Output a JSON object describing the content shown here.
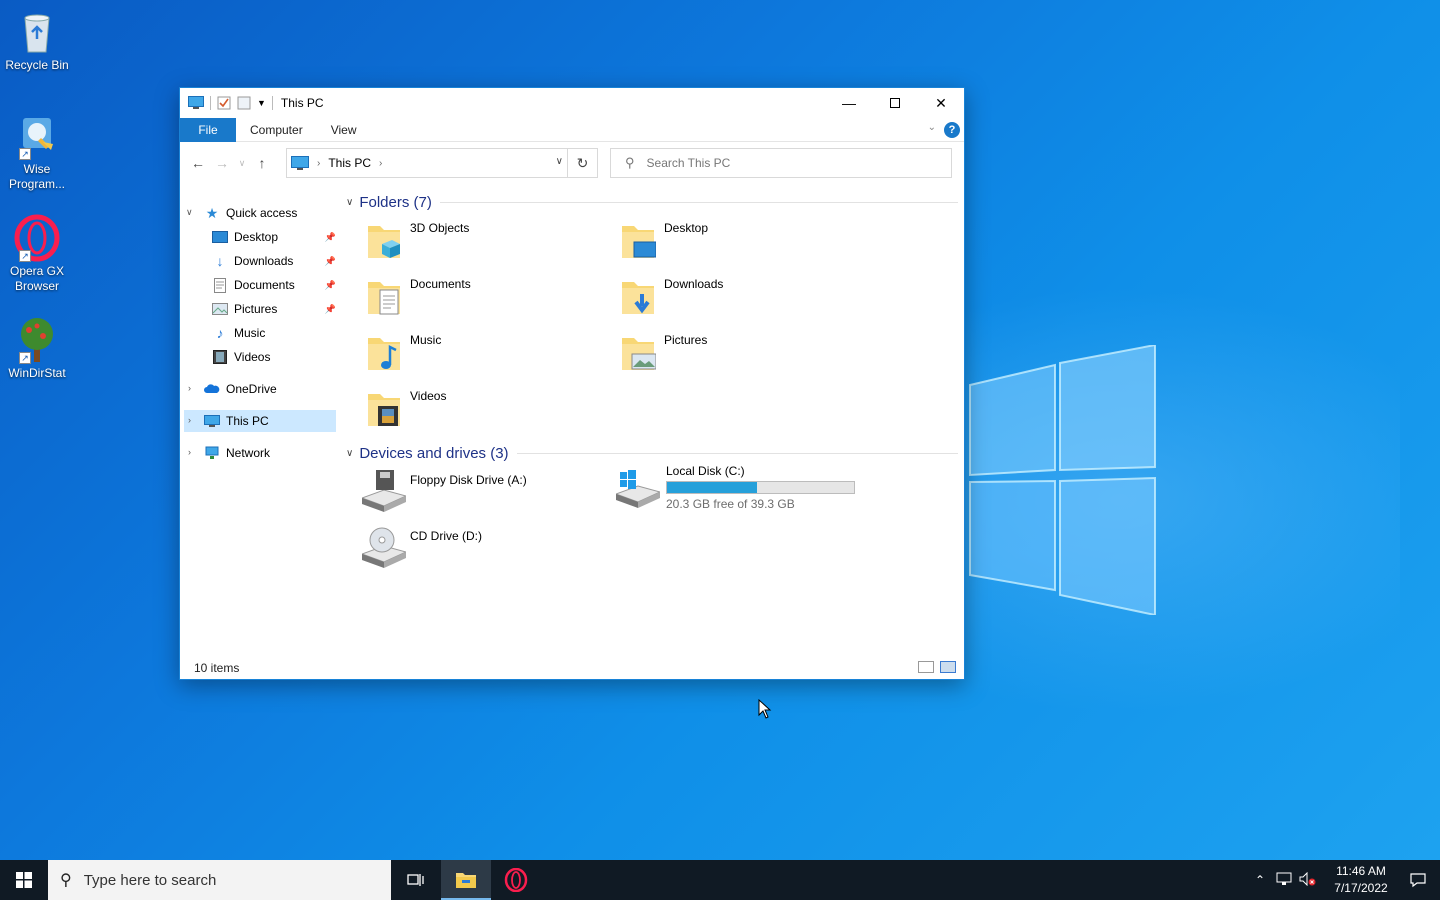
{
  "desktop": {
    "icons": [
      {
        "label": "Recycle Bin",
        "icon": "recycle-bin-icon"
      },
      {
        "label": "Wise Program...",
        "icon": "wise-program-uninstaller-icon"
      },
      {
        "label": "Opera GX Browser",
        "icon": "opera-gx-icon"
      },
      {
        "label": "WinDirStat",
        "icon": "windirstat-icon"
      }
    ]
  },
  "window": {
    "title": "This PC",
    "ribbon_tabs": [
      "File",
      "Computer",
      "View"
    ],
    "help": "?",
    "address": {
      "crumb": "This PC"
    },
    "search": {
      "placeholder": "Search This PC"
    },
    "nav": {
      "quick_access": "Quick access",
      "items": [
        {
          "label": "Desktop",
          "icon": "desktop-icon",
          "pinned": true
        },
        {
          "label": "Downloads",
          "icon": "downloads-icon",
          "pinned": true
        },
        {
          "label": "Documents",
          "icon": "documents-icon",
          "pinned": true
        },
        {
          "label": "Pictures",
          "icon": "pictures-icon",
          "pinned": true
        },
        {
          "label": "Music",
          "icon": "music-icon",
          "pinned": false
        },
        {
          "label": "Videos",
          "icon": "videos-icon",
          "pinned": false
        }
      ],
      "onedrive": "OneDrive",
      "thispc": "This PC",
      "network": "Network"
    },
    "folders_header": "Folders (7)",
    "folders": [
      {
        "name": "3D Objects",
        "icon": "3d-objects-folder-icon"
      },
      {
        "name": "Desktop",
        "icon": "desktop-folder-icon"
      },
      {
        "name": "Documents",
        "icon": "documents-folder-icon"
      },
      {
        "name": "Downloads",
        "icon": "downloads-folder-icon"
      },
      {
        "name": "Music",
        "icon": "music-folder-icon"
      },
      {
        "name": "Pictures",
        "icon": "pictures-folder-icon"
      },
      {
        "name": "Videos",
        "icon": "videos-folder-icon"
      }
    ],
    "drives_header": "Devices and drives (3)",
    "drives": [
      {
        "name": "Floppy Disk Drive (A:)",
        "icon": "floppy-drive-icon"
      },
      {
        "name": "Local Disk (C:)",
        "icon": "local-disk-icon",
        "free": "20.3 GB free of 39.3 GB",
        "used_fraction": 0.48
      },
      {
        "name": "CD Drive (D:)",
        "icon": "cd-drive-icon"
      }
    ],
    "status": "10 items"
  },
  "taskbar": {
    "search_placeholder": "Type here to search",
    "time": "11:46 AM",
    "date": "7/17/2022"
  },
  "colors": {
    "accent": "#1979ca",
    "selection": "#cce8ff",
    "folder_yellow": "#f8d775",
    "disk_bar": "#26a0da"
  }
}
